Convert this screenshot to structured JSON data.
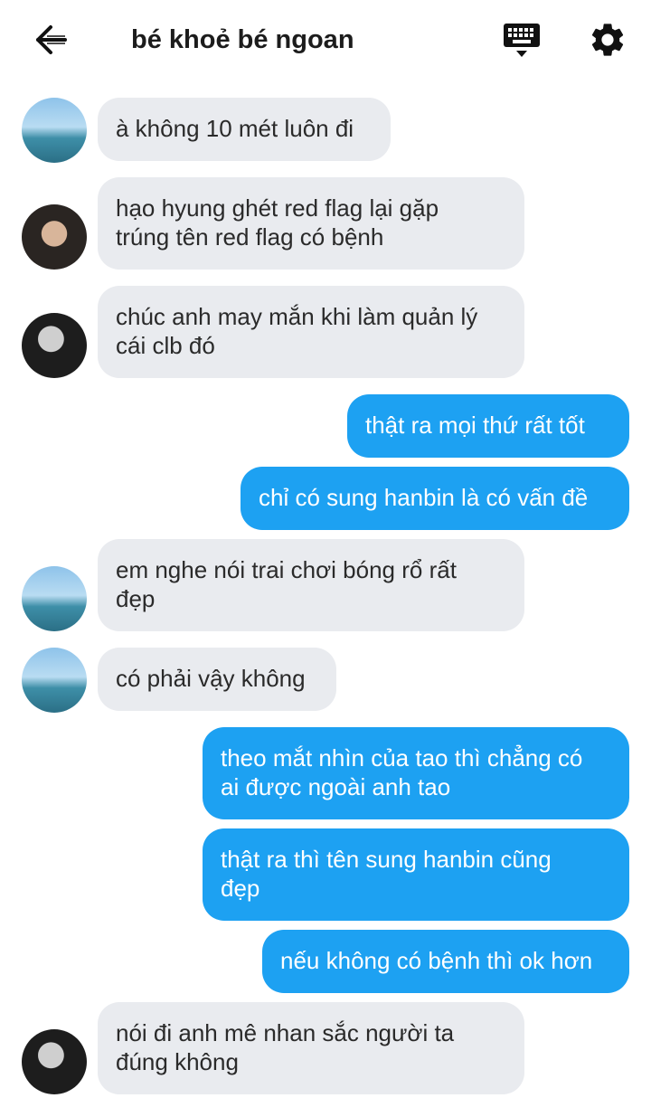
{
  "header": {
    "title": "bé khoẻ bé ngoan",
    "back_icon": "arrow-left-icon",
    "keyboard_icon": "keyboard-icon",
    "settings_icon": "gear-icon"
  },
  "colors": {
    "incoming_bubble": "#e9ebef",
    "outgoing_bubble": "#1da1f2",
    "incoming_text": "#2a2a2a",
    "outgoing_text": "#ffffff"
  },
  "messages": [
    {
      "direction": "in",
      "avatar": "avatar-beach",
      "text": "à không 10 mét luôn đi"
    },
    {
      "direction": "in",
      "avatar": "avatar-dark",
      "text": "hạo hyung ghét red flag lại gặp\ntrúng tên red flag có bệnh"
    },
    {
      "direction": "in",
      "avatar": "avatar-mono",
      "text": "chúc anh may mắn khi làm quản lý\ncái clb đó"
    },
    {
      "direction": "out",
      "text": "thật ra mọi thứ rất tốt"
    },
    {
      "direction": "out",
      "text": "chỉ có sung hanbin là có vấn đề"
    },
    {
      "direction": "in",
      "avatar": "avatar-beach",
      "text": "em nghe nói trai chơi bóng rổ rất\nđẹp"
    },
    {
      "direction": "in",
      "avatar": "avatar-beach",
      "text": "có phải vậy không"
    },
    {
      "direction": "out",
      "text": "theo mắt nhìn của tao thì chẳng có\nai được ngoài anh tao"
    },
    {
      "direction": "out",
      "text": "thật ra thì tên sung hanbin cũng\nđẹp"
    },
    {
      "direction": "out",
      "text": "nếu không có bệnh thì ok hơn"
    },
    {
      "direction": "in",
      "avatar": "avatar-mono",
      "text": "nói đi anh mê nhan sắc người ta\nđúng không"
    }
  ]
}
